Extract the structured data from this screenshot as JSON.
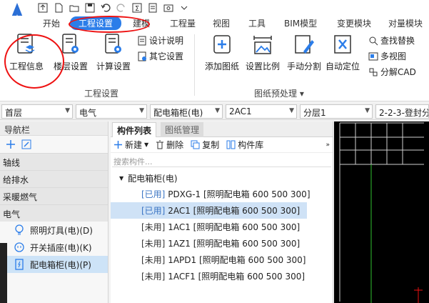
{
  "quick_access": {
    "icons": [
      "upload-icon",
      "new-file-icon",
      "open-folder-icon",
      "save-icon",
      "undo-icon",
      "redo-icon",
      "sum-icon",
      "sheet-icon",
      "capture-icon",
      "dropdown-icon"
    ]
  },
  "tabs": {
    "items": [
      "开始",
      "工程设置",
      "建模",
      "工程量",
      "视图",
      "工具",
      "BIM模型",
      "变更模块",
      "对量模块"
    ],
    "active": "工程设置"
  },
  "ribbon": {
    "project_group": {
      "label": "工程设置",
      "project_info": "工程信息",
      "floor_settings": "楼层设置",
      "calc_settings": "计算设置",
      "design_notes": "设计说明",
      "other_settings": "其它设置"
    },
    "drawing_group": {
      "label": "图纸预处理",
      "add_drawing": "添加图纸",
      "set_scale": "设置比例",
      "manual_split": "手动分割",
      "auto_locate": "自动定位",
      "find_replace": "查找替换",
      "multi_view": "多视图",
      "decompose_cad": "分解CAD"
    }
  },
  "dropdowns": {
    "floor": "首层",
    "discipline": "电气",
    "category": "配电箱柜(电)",
    "component": "2AC1",
    "layer": "分层1",
    "drawing": "2-2-3-登封分"
  },
  "nav": {
    "title": "导航栏",
    "categories": [
      "轴线",
      "给排水",
      "采暖燃气",
      "电气"
    ],
    "items": [
      {
        "label": "照明灯具(电)(D)",
        "icon": "bulb-icon"
      },
      {
        "label": "开关插座(电)(K)",
        "icon": "socket-icon"
      },
      {
        "label": "配电箱柜(电)(P)",
        "icon": "cabinet-icon"
      }
    ]
  },
  "component_panel": {
    "tabs": [
      "构件列表",
      "图纸管理"
    ],
    "toolbar": {
      "new": "新建",
      "delete": "删除",
      "copy": "复制",
      "library": "构件库"
    },
    "search_placeholder": "搜索构件...",
    "parent": "配电箱柜(电)",
    "items": [
      {
        "status": "[已用]",
        "name": "PDXG-1 [照明配电箱 600 500 300]",
        "used": true
      },
      {
        "status": "[已用]",
        "name": "2AC1 [照明配电箱 600 500 300]",
        "used": true,
        "selected": true
      },
      {
        "status": "[未用]",
        "name": "1AC1 [照明配电箱 600 500 300]",
        "used": false
      },
      {
        "status": "[未用]",
        "name": "1AZ1 [照明配电箱 600 500 300]",
        "used": false
      },
      {
        "status": "[未用]",
        "name": "1APD1 [照明配电箱 600 500 300]",
        "used": false
      },
      {
        "status": "[未用]",
        "name": "1ACF1 [照明配电箱 600 500 300]",
        "used": false
      }
    ]
  },
  "colors": {
    "accent": "#2b7de9",
    "annotation": "#e11111",
    "used_text": "#3a74c4",
    "selection": "#cfe2f6",
    "canvas": "#000000"
  }
}
